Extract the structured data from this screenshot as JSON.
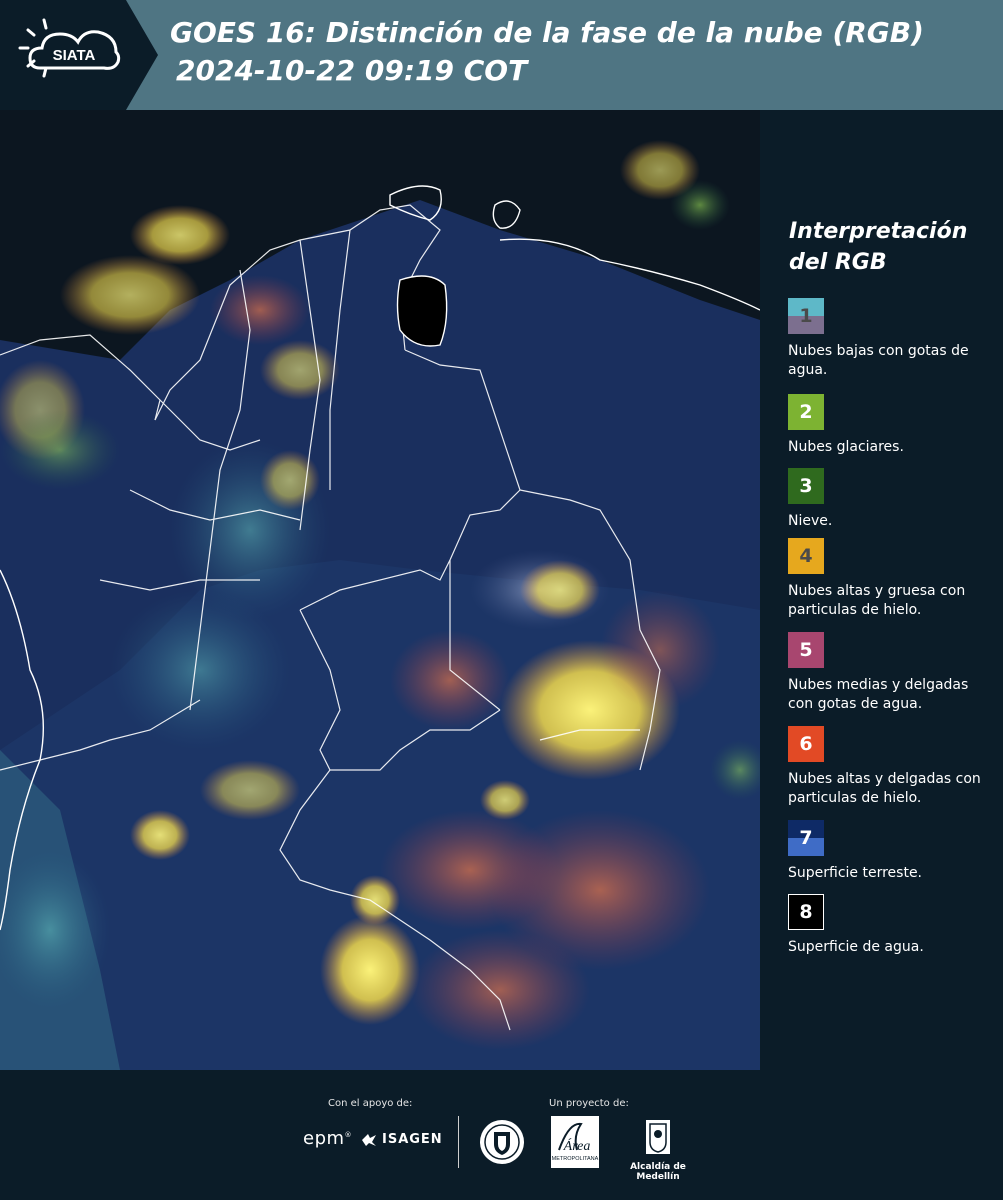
{
  "header": {
    "logo_text": "SIATA",
    "title_line1": "GOES 16: Distinción de la fase de la nube (RGB)",
    "title_line2": "2024-10-22 09:19 COT"
  },
  "legend": {
    "title": "Interpretación del RGB",
    "items": [
      {
        "number": "1",
        "label": "Nubes bajas con gotas de agua.",
        "color_top": "#5eb8c8",
        "color_bottom": "#7c6f8f",
        "text_color": "#4a4a4a"
      },
      {
        "number": "2",
        "label": "Nubes glaciares.",
        "color_top": "#7db332",
        "color_bottom": "#7db332",
        "text_color": "#ffffff"
      },
      {
        "number": "3",
        "label": "Nieve.",
        "color_top": "#2f6a1e",
        "color_bottom": "#2f6a1e",
        "text_color": "#ffffff"
      },
      {
        "number": "4",
        "label": "Nubes altas y gruesa con particulas de hielo.",
        "color_top": "#e6a81e",
        "color_bottom": "#e6a81e",
        "text_color": "#4a4a4a"
      },
      {
        "number": "5",
        "label": "Nubes medias y delgadas con gotas de agua.",
        "color_top": "#a8466f",
        "color_bottom": "#a8466f",
        "text_color": "#ffffff"
      },
      {
        "number": "6",
        "label": "Nubes altas y delgadas con particulas de hielo.",
        "color_top": "#e24a25",
        "color_bottom": "#e24a25",
        "text_color": "#ffffff"
      },
      {
        "number": "7",
        "label": "Superficie terreste.",
        "color_top": "#0e2a66",
        "color_bottom": "#3f6cc6",
        "text_color": "#ffffff"
      },
      {
        "number": "8",
        "label": "Superficie de agua.",
        "color_top": "#000000",
        "color_bottom": "#000000",
        "text_color": "#ffffff",
        "border": "#ffffff"
      }
    ]
  },
  "footer": {
    "support_label": "Con el apoyo de:",
    "project_label": "Un proyecto de:",
    "sponsor_epm": "epm",
    "sponsor_isagen": "ISAGEN",
    "area_name": "Área",
    "area_subtitle": "METROPOLITANA",
    "alcaldia_label": "Alcaldía de Medellín"
  },
  "colors": {
    "header_bg": "#4f7583",
    "page_bg": "#0b1c28",
    "accent_yellow": "#f5e66a",
    "accent_orange": "#d46a42",
    "accent_cyan": "#5fd0c8"
  }
}
